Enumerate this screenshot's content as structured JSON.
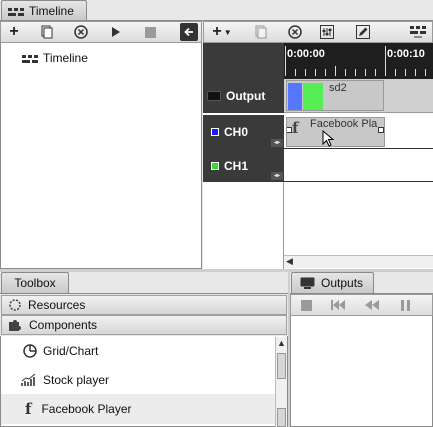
{
  "tabs": {
    "timeline": "Timeline",
    "toolbox": "Toolbox",
    "outputs": "Outputs"
  },
  "tree": {
    "root_label": "Timeline"
  },
  "ruler": {
    "start": "0:00:00",
    "next": "0:00:10"
  },
  "tracks": [
    {
      "name": "Output",
      "clip_label": "sd2"
    },
    {
      "name": "CH0",
      "color": "#1a1aff",
      "clip_label": "Facebook Pla"
    },
    {
      "name": "CH1",
      "color": "#33dd33"
    }
  ],
  "toolbox": {
    "sections": [
      "Resources",
      "Components"
    ],
    "items": [
      "Grid/Chart",
      "Stock player",
      "Facebook Player"
    ]
  },
  "colors": {
    "track_head": "#3a3a3a",
    "output_blue": "#5577ff",
    "output_green": "#55ee55"
  }
}
